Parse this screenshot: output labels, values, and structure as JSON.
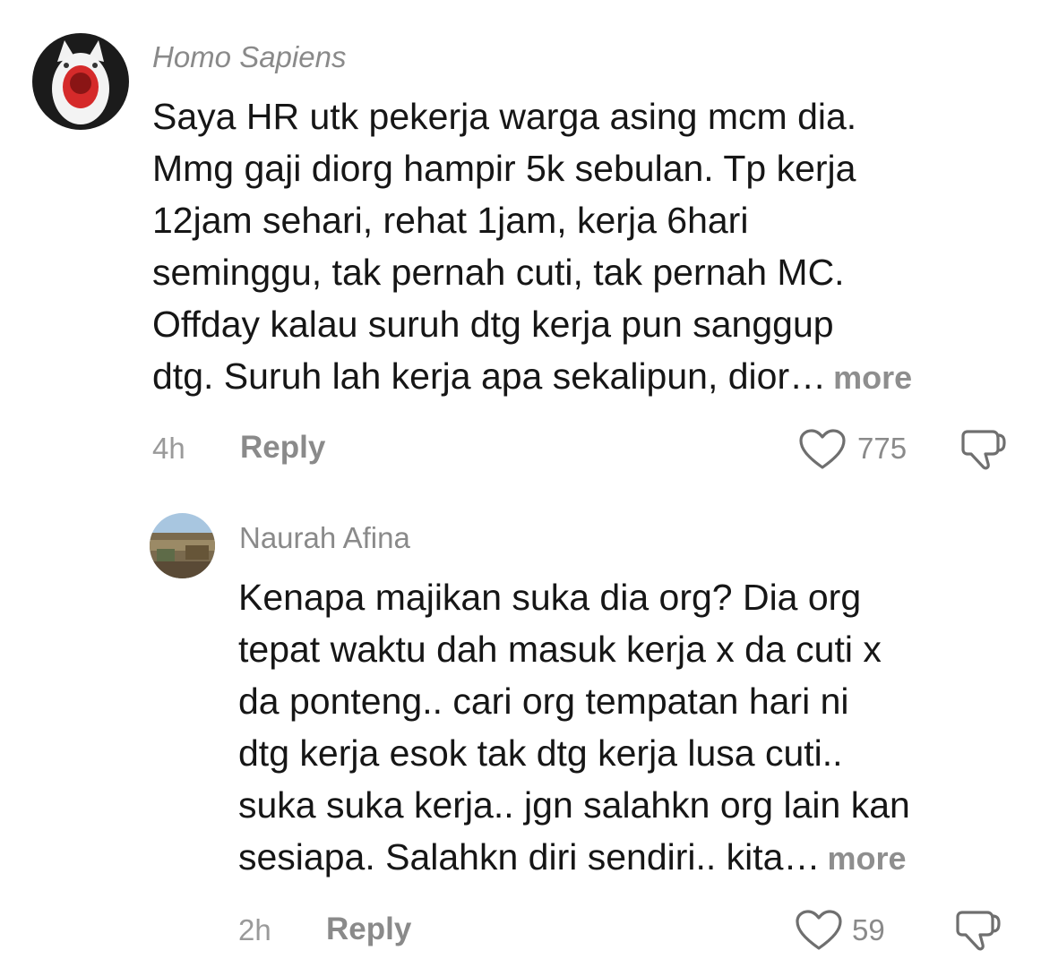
{
  "comments": [
    {
      "username": "Homo Sapiens",
      "avatar_icon": "screaming-cat-avatar",
      "body_lines": [
        "Saya HR utk pekerja warga asing mcm dia.",
        "Mmg gaji diorg hampir 5k sebulan. Tp kerja",
        "12jam sehari, rehat 1jam, kerja 6hari",
        "seminggu, tak pernah cuti, tak pernah MC.",
        "Offday kalau suruh dtg kerja pun sanggup",
        "dtg. Suruh lah kerja apa sekalipun, dior…"
      ],
      "more_label": "more",
      "time": "4h",
      "reply_label": "Reply",
      "like_count": "775",
      "like_icon": "heart-icon",
      "dislike_icon": "thumbs-down-icon"
    },
    {
      "username": "Naurah Afina",
      "avatar_icon": "landscape-avatar",
      "body_lines": [
        "Kenapa majikan suka dia org? Dia org",
        "tepat waktu dah masuk kerja x da cuti x",
        "da ponteng.. cari org tempatan hari ni",
        "dtg kerja esok tak dtg kerja lusa cuti..",
        "suka suka kerja.. jgn salahkn org lain kan",
        "sesiapa. Salahkn diri sendiri.. kita…"
      ],
      "more_label": "more",
      "time": "2h",
      "reply_label": "Reply",
      "like_count": "59",
      "like_icon": "heart-icon",
      "dislike_icon": "thumbs-down-icon"
    }
  ]
}
